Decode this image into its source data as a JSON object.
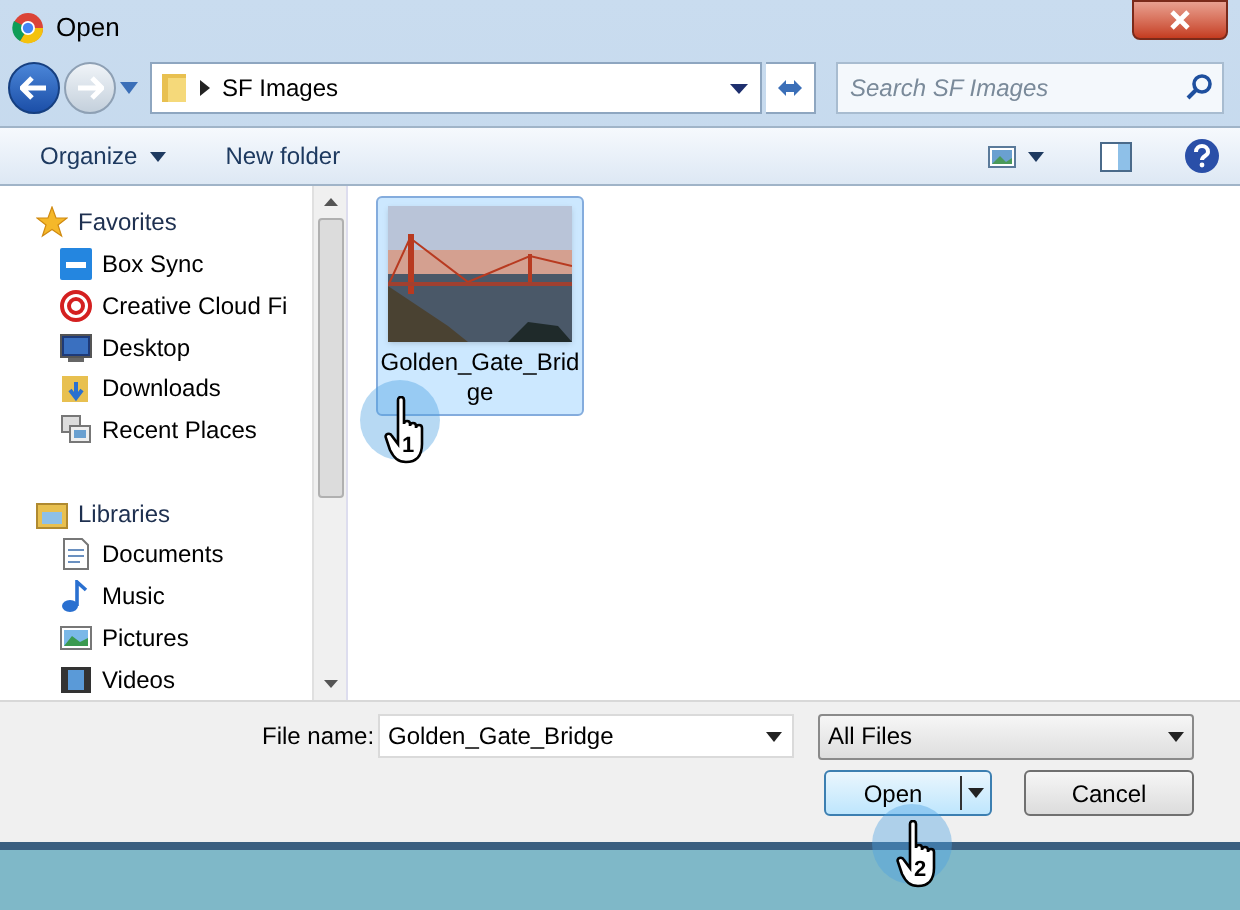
{
  "window": {
    "title": "Open"
  },
  "address": {
    "folder": "SF Images"
  },
  "search": {
    "placeholder": "Search SF Images"
  },
  "toolbar": {
    "organize": "Organize",
    "new_folder": "New folder"
  },
  "sidebar": {
    "items": [
      {
        "kind": "group",
        "label": "Favorites"
      },
      {
        "kind": "item",
        "label": "Box Sync"
      },
      {
        "kind": "item",
        "label": "Creative Cloud Fi"
      },
      {
        "kind": "item",
        "label": "Desktop"
      },
      {
        "kind": "item",
        "label": "Downloads"
      },
      {
        "kind": "item",
        "label": "Recent Places"
      },
      {
        "kind": "spacer"
      },
      {
        "kind": "group",
        "label": "Libraries"
      },
      {
        "kind": "item",
        "label": "Documents"
      },
      {
        "kind": "item",
        "label": "Music"
      },
      {
        "kind": "item",
        "label": "Pictures"
      },
      {
        "kind": "item",
        "label": "Videos"
      }
    ]
  },
  "files": [
    {
      "name": "Golden_Gate_Brid ge",
      "selected": true,
      "kind": "picture"
    }
  ],
  "file_name": {
    "label": "File name:",
    "value": "Golden_Gate_Bridge"
  },
  "file_type": {
    "value": "All Files"
  },
  "buttons": {
    "open": "Open",
    "cancel": "Cancel"
  },
  "annotations": [
    {
      "label": "1"
    },
    {
      "label": "2"
    }
  ]
}
